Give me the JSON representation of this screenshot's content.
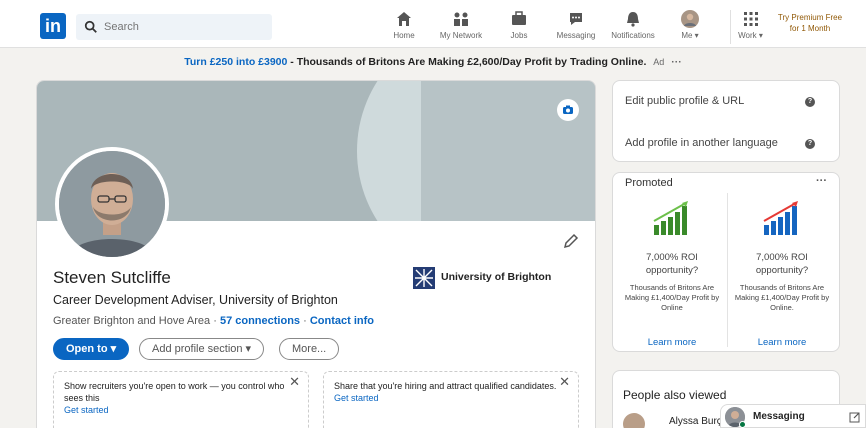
{
  "brand": {
    "logo_text": "in"
  },
  "search": {
    "placeholder": "Search"
  },
  "nav": [
    {
      "label": "Home",
      "icon": "home-icon"
    },
    {
      "label": "My Network",
      "icon": "network-icon"
    },
    {
      "label": "Jobs",
      "icon": "briefcase-icon"
    },
    {
      "label": "Messaging",
      "icon": "messaging-icon"
    },
    {
      "label": "Notifications",
      "icon": "bell-icon"
    },
    {
      "label": "Me",
      "icon": "avatar"
    },
    {
      "label": "Work",
      "icon": "grid-icon"
    }
  ],
  "premium": {
    "line1": "Try Premium Free",
    "line2": "for 1 Month"
  },
  "ad_banner": {
    "highlight": "Turn £250 into £3900",
    "rest": " - Thousands of Britons Are Making £2,600/Day Profit by Trading Online.",
    "tag": "Ad",
    "dots": "···"
  },
  "profile": {
    "name": "Steven Sutcliffe",
    "headline": "Career Development Adviser, University of Brighton",
    "location": "Greater Brighton and Hove Area",
    "separator": "·",
    "connections": "57 connections",
    "contact": "Contact info",
    "university": "University of Brighton",
    "buttons": {
      "open_to": "Open to",
      "add_section": "Add profile section",
      "more": "More..."
    }
  },
  "tips": [
    {
      "before": "Show recruiters you're open to work",
      "after": " — you control who sees this",
      "link": "Get started",
      "close": "✕"
    },
    {
      "before": "Share that you're hiring",
      "after": " and attract qualified candidates.",
      "link": "Get started",
      "close": "✕"
    }
  ],
  "side": {
    "edit_public": "Edit public profile & URL",
    "add_language": "Add profile in another language",
    "help_glyph": "?"
  },
  "promoted": {
    "title": "Promoted",
    "dots": "···",
    "items": [
      {
        "roi": "7,000% ROI opportunity?",
        "desc": "Thousands of Britons Are Making £1,400/Day Profit by Online",
        "link": "Learn more",
        "color": "#3a8a2a"
      },
      {
        "roi": "7,000% ROI opportunity?",
        "desc": "Thousands of Britons Are Making £1,400/Day Profit by Online.",
        "link": "Learn more",
        "color": "#1565c0"
      }
    ]
  },
  "people_also_viewed": {
    "title": "People also viewed",
    "first_person": "Alyssa Burç"
  },
  "messaging": {
    "label": "Messaging"
  },
  "colors": {
    "accent": "#0a66c2",
    "premium": "#915907",
    "background": "#f3f2ef"
  }
}
